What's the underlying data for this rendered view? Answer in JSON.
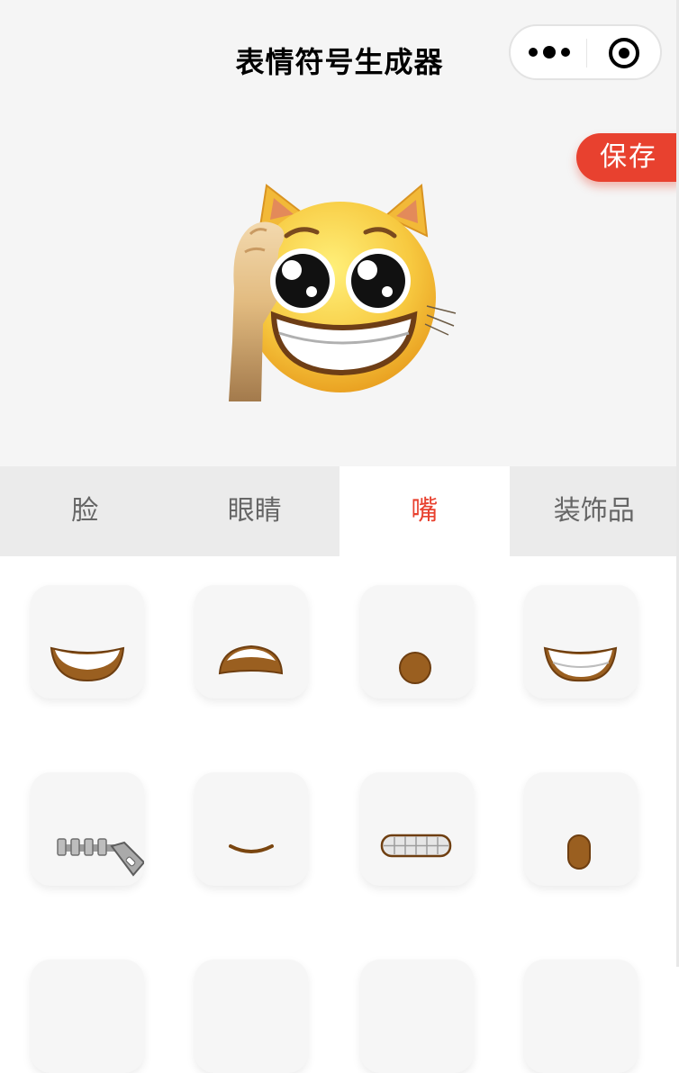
{
  "nav": {
    "title": "表情符号生成器"
  },
  "toolbar": {
    "save_label": "保存"
  },
  "tabs": [
    {
      "label": "脸",
      "active": false
    },
    {
      "label": "眼睛",
      "active": false
    },
    {
      "label": "嘴",
      "active": true
    },
    {
      "label": "装饰品",
      "active": false
    }
  ],
  "colors": {
    "accent": "#e8412f",
    "tab_inactive_bg": "#ebebeb",
    "preview_bg": "#f5f5f5"
  },
  "mouth_options": [
    "wide-grin-mouth-icon",
    "open-frown-mouth-icon",
    "small-o-mouth-icon",
    "teeth-smile-mouth-icon",
    "zipper-mouth-icon",
    "slight-smile-mouth-icon",
    "grimace-teeth-mouth-icon",
    "oval-open-mouth-icon"
  ]
}
